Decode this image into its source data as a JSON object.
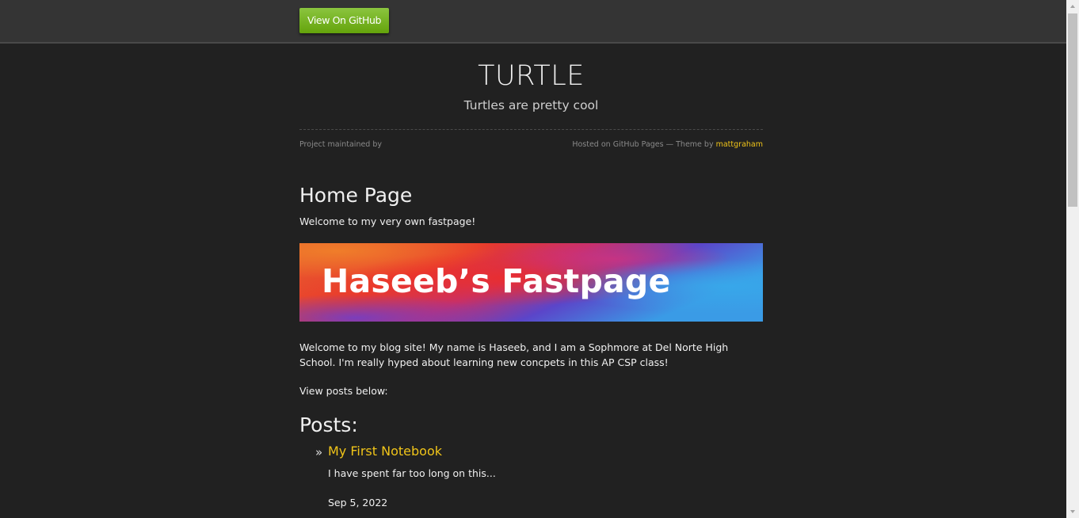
{
  "header": {
    "github_button_label": "View On GitHub"
  },
  "site": {
    "title": "TURTLE",
    "subtitle": "Turtles are pretty cool"
  },
  "meta": {
    "maintained_by": "Project maintained by",
    "hosted_text": "Hosted on GitHub Pages — Theme by",
    "theme_author": "mattgraham"
  },
  "main": {
    "heading": "Home Page",
    "welcome": "Welcome to my very own fastpage!",
    "banner_text": "Haseeb’s Fastpage",
    "intro": "Welcome to my blog site! My name is Haseeb, and I am a Sophmore at Del Norte High School. I'm really hyped about learning new concpets in this AP CSP class!",
    "view_posts": "View posts below:",
    "posts_heading": "Posts:",
    "posts": [
      {
        "bullet": "»",
        "title": "My First Notebook",
        "description": "I have spent far too long on this...",
        "date": "Sep 5, 2022"
      }
    ]
  },
  "colors": {
    "background": "#212121",
    "topbar": "#343434",
    "button_green": "#7ab51d",
    "link_yellow": "#f0c419"
  },
  "icons": {
    "scroll_up": "triangle-up",
    "scroll_down": "triangle-down"
  }
}
